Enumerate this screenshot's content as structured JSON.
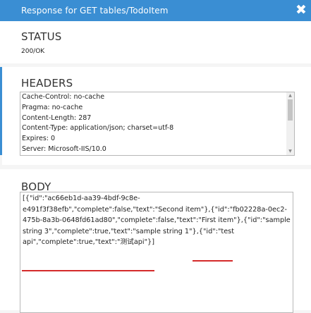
{
  "window": {
    "title": "Response for GET tables/TodoItem",
    "close_glyph": "✖"
  },
  "status": {
    "label": "STATUS",
    "value": "200/OK"
  },
  "headers": {
    "label": "HEADERS",
    "lines": [
      "Cache-Control: no-cache",
      "Pragma: no-cache",
      "Content-Length: 287",
      "Content-Type: application/json; charset=utf-8",
      "Expires: 0",
      "Server: Microsoft-IIS/10.0"
    ]
  },
  "body": {
    "label": "BODY",
    "lines": [
      "[{\"id\":\"ac66eb1d-aa39-4bdf-9c8e-",
      "e491f3f38efb\",\"complete\":false,\"text\":\"Second item\"},{\"id\":\"fb02228a-0ec2-",
      "475b-8a3b-0648fd61ad80\",\"complete\":false,\"text\":\"First item\"},{\"id\":\"sample",
      "string 3\",\"complete\":true,\"text\":\"sample string 1\"},{\"id\":\"test",
      "api\",\"complete\":true,\"text\":\"测试api\"}]"
    ]
  },
  "colors": {
    "titlebar": "#3a8ed3",
    "annotation": "#d42a2a"
  }
}
